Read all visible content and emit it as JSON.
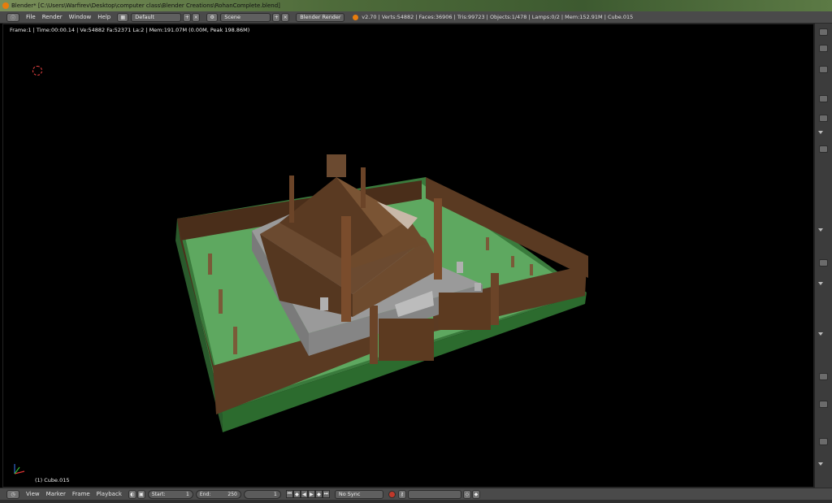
{
  "window": {
    "title": "Blender* [C:\\Users\\Warfirev\\Desktop\\computer class\\Blender Creations\\RohanComplete.blend]"
  },
  "menubar": {
    "menus": [
      "File",
      "Render",
      "Window",
      "Help"
    ],
    "screen_layout": "Default",
    "scene": "Scene",
    "render_engine": "Blender Render",
    "stats": "v2.70 | Verts:54882 | Faces:36906 | Tris:99723 | Objects:1/478 | Lamps:0/2 | Mem:152.91M | Cube.015"
  },
  "viewport": {
    "info": "Frame:1 | Time:00:00.14 | Ve:54882 Fa:52371 La:2 | Mem:191.07M (0.00M, Peak 198.86M)",
    "active_object": "(1) Cube.015"
  },
  "timeline": {
    "menus": [
      "View",
      "Marker",
      "Frame",
      "Playback"
    ],
    "start_label": "Start:",
    "start_value": "1",
    "end_label": "End:",
    "end_value": "250",
    "current_frame": "1",
    "sync": "No Sync"
  },
  "colors": {
    "header_bg": "#4a4a4a",
    "viewport_bg": "#000000",
    "grass": "#5ea860",
    "fence": "#5a3a22",
    "roof": "#6b4a30",
    "platform": "#9a9a9a",
    "accent": "#e87d0d"
  }
}
